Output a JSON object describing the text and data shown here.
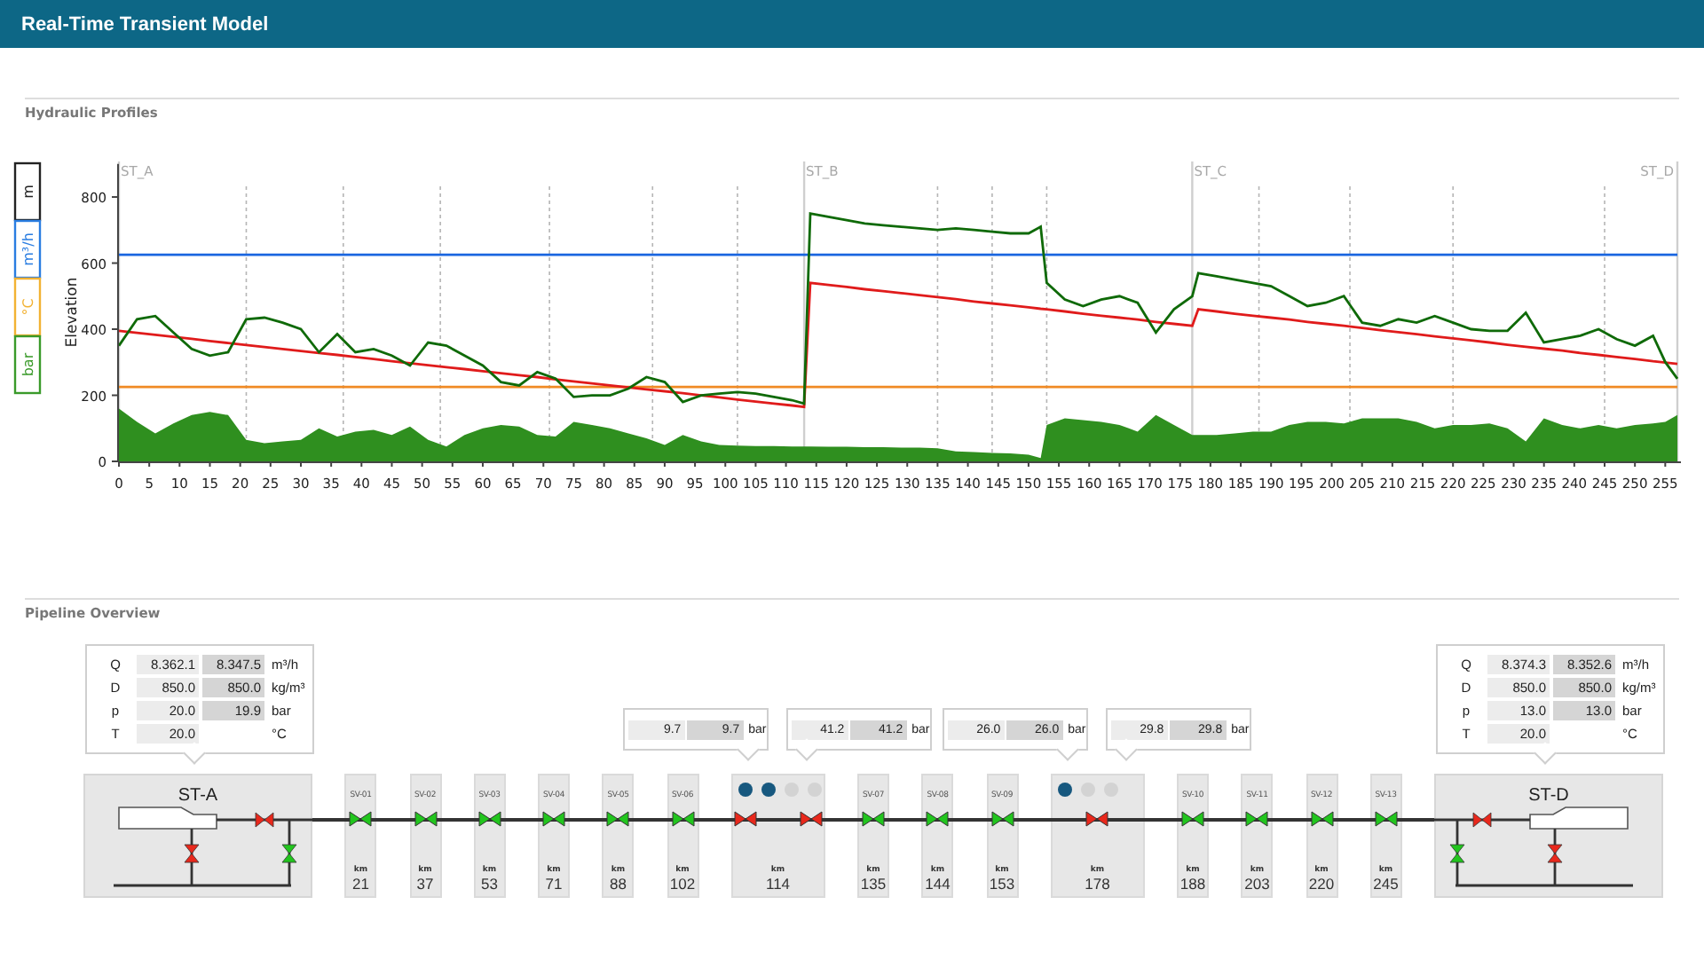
{
  "header": {
    "title": "Real-Time Transient Model"
  },
  "hydraulic_profiles": {
    "title": "Hydraulic Profiles",
    "unit_tabs": [
      {
        "label": "m",
        "color": "#222222"
      },
      {
        "label": "m³/h",
        "color": "#2a7de1"
      },
      {
        "label": "°C",
        "color": "#f2b233"
      },
      {
        "label": "bar",
        "color": "#3a9a2a"
      }
    ],
    "chart_data": {
      "type": "line",
      "ylabel": "Elevation",
      "xlim": [
        0,
        257
      ],
      "ylim": [
        0,
        900
      ],
      "xticks": [
        0,
        5,
        10,
        15,
        20,
        25,
        30,
        35,
        40,
        45,
        50,
        55,
        60,
        65,
        70,
        75,
        80,
        85,
        90,
        95,
        100,
        105,
        110,
        115,
        120,
        125,
        130,
        135,
        140,
        145,
        150,
        155,
        160,
        165,
        170,
        175,
        180,
        185,
        190,
        195,
        200,
        205,
        210,
        215,
        220,
        225,
        230,
        235,
        240,
        245,
        250,
        255
      ],
      "yticks": [
        0,
        200,
        400,
        600,
        800
      ],
      "grid": true,
      "ref_lines": [
        {
          "axis": "x",
          "value": 0,
          "label": "ST_A"
        },
        {
          "axis": "x",
          "value": 113,
          "label": "ST_B"
        },
        {
          "axis": "x",
          "value": 177,
          "label": "ST_C"
        },
        {
          "axis": "x",
          "value": 257,
          "label": "ST_D"
        }
      ],
      "x": [
        0,
        3,
        6,
        9,
        12,
        15,
        18,
        21,
        24,
        27,
        30,
        33,
        36,
        39,
        42,
        45,
        48,
        51,
        54,
        57,
        60,
        63,
        66,
        69,
        72,
        75,
        78,
        81,
        84,
        87,
        90,
        93,
        96,
        99,
        102,
        105,
        108,
        111,
        113,
        114,
        117,
        120,
        123,
        126,
        129,
        132,
        135,
        138,
        141,
        144,
        147,
        150,
        152,
        153,
        156,
        159,
        162,
        165,
        168,
        171,
        174,
        177,
        178,
        181,
        184,
        187,
        190,
        193,
        196,
        199,
        202,
        205,
        208,
        211,
        214,
        217,
        220,
        223,
        226,
        229,
        232,
        235,
        238,
        241,
        244,
        247,
        250,
        253,
        255,
        257
      ],
      "series": [
        {
          "type": "area",
          "color": "#2f8f1f",
          "values": [
            160,
            120,
            85,
            115,
            140,
            150,
            140,
            65,
            55,
            60,
            65,
            100,
            75,
            90,
            95,
            80,
            105,
            65,
            45,
            80,
            100,
            110,
            105,
            80,
            75,
            120,
            110,
            100,
            85,
            70,
            50,
            80,
            60,
            50,
            48,
            46,
            46,
            45,
            45,
            45,
            44,
            44,
            43,
            43,
            42,
            42,
            40,
            30,
            28,
            26,
            24,
            20,
            10,
            110,
            130,
            125,
            120,
            110,
            90,
            140,
            110,
            80,
            80,
            80,
            85,
            90,
            90,
            110,
            120,
            120,
            115,
            130,
            130,
            130,
            120,
            100,
            110,
            110,
            115,
            100,
            60,
            130,
            110,
            100,
            110,
            100,
            110,
            115,
            120,
            140
          ]
        },
        {
          "color": "#f08a24",
          "values": [
            225,
            225,
            225,
            225,
            225,
            225,
            225,
            225,
            225,
            225,
            225,
            225,
            225,
            225,
            225,
            225,
            225,
            225,
            225,
            225,
            225,
            225,
            225,
            225,
            225,
            225,
            225,
            225,
            225,
            225,
            225,
            225,
            225,
            225,
            225,
            225,
            225,
            225,
            225,
            225,
            225,
            225,
            225,
            225,
            225,
            225,
            225,
            225,
            225,
            225,
            225,
            225,
            225,
            225,
            225,
            225,
            225,
            225,
            225,
            225,
            225,
            225,
            225,
            225,
            225,
            225,
            225,
            225,
            225,
            225,
            225,
            225,
            225,
            225,
            225,
            225,
            225,
            225,
            225,
            225,
            225,
            225,
            225,
            225,
            225,
            225,
            225,
            225,
            225,
            225
          ]
        },
        {
          "color": "#1a66e0",
          "values": [
            625,
            625,
            625,
            625,
            625,
            625,
            625,
            625,
            625,
            625,
            625,
            625,
            625,
            625,
            625,
            625,
            625,
            625,
            625,
            625,
            625,
            625,
            625,
            625,
            625,
            625,
            625,
            625,
            625,
            625,
            625,
            625,
            625,
            625,
            625,
            625,
            625,
            625,
            625,
            625,
            625,
            625,
            625,
            625,
            625,
            625,
            625,
            625,
            625,
            625,
            625,
            625,
            625,
            625,
            625,
            625,
            625,
            625,
            625,
            625,
            625,
            625,
            625,
            625,
            625,
            625,
            625,
            625,
            625,
            625,
            625,
            625,
            625,
            625,
            625,
            625,
            625,
            625,
            625,
            625,
            625,
            625,
            625,
            625,
            625,
            625,
            625,
            625,
            625,
            625
          ]
        },
        {
          "color": "#e01b1b",
          "values": [
            395,
            389,
            383,
            377,
            371,
            364,
            358,
            352,
            346,
            340,
            334,
            328,
            322,
            316,
            310,
            303,
            297,
            291,
            285,
            279,
            273,
            267,
            261,
            255,
            248,
            242,
            236,
            230,
            224,
            218,
            212,
            206,
            200,
            194,
            187,
            181,
            175,
            169,
            165,
            540,
            534,
            528,
            521,
            515,
            509,
            503,
            497,
            491,
            484,
            478,
            472,
            466,
            462,
            460,
            454,
            447,
            441,
            435,
            429,
            422,
            416,
            410,
            460,
            454,
            447,
            441,
            435,
            429,
            422,
            416,
            410,
            404,
            397,
            391,
            385,
            378,
            372,
            366,
            360,
            353,
            347,
            341,
            335,
            328,
            322,
            316,
            310,
            303,
            299,
            295
          ]
        },
        {
          "color": "#0f6a08",
          "values": [
            350,
            430,
            440,
            390,
            340,
            320,
            330,
            430,
            435,
            420,
            400,
            330,
            385,
            330,
            340,
            320,
            290,
            360,
            350,
            320,
            290,
            240,
            230,
            270,
            250,
            195,
            200,
            200,
            220,
            255,
            240,
            180,
            200,
            205,
            210,
            205,
            195,
            185,
            175,
            750,
            740,
            730,
            720,
            715,
            710,
            705,
            700,
            705,
            700,
            695,
            690,
            690,
            710,
            540,
            490,
            470,
            490,
            500,
            480,
            390,
            460,
            500,
            570,
            560,
            550,
            540,
            530,
            500,
            470,
            480,
            500,
            420,
            410,
            430,
            420,
            440,
            420,
            400,
            395,
            395,
            450,
            360,
            370,
            380,
            400,
            370,
            350,
            380,
            300,
            250
          ]
        }
      ]
    }
  },
  "pipeline_overview": {
    "title": "Pipeline Overview",
    "items": [
      {
        "kind": "station",
        "name": "ST-A",
        "mirrored": false,
        "valves": [
          {
            "open": false
          },
          {
            "open": false
          },
          {
            "open": true
          }
        ],
        "popup": {
          "rows": [
            {
              "label": "Q",
              "values": [
                "8.362.1",
                "8.347.5"
              ],
              "unit": "m³/h"
            },
            {
              "label": "D",
              "values": [
                "850.0",
                "850.0"
              ],
              "unit": "kg/m³"
            },
            {
              "label": "p",
              "values": [
                "20.0",
                "19.9"
              ],
              "unit": "bar"
            },
            {
              "label": "T",
              "values": [
                "20.0"
              ],
              "unit": "°C"
            }
          ]
        }
      },
      {
        "kind": "valve",
        "name": "SV-01",
        "km_label": "km",
        "km": "21",
        "open": true
      },
      {
        "kind": "valve",
        "name": "SV-02",
        "km_label": "km",
        "km": "37",
        "open": true
      },
      {
        "kind": "valve",
        "name": "SV-03",
        "km_label": "km",
        "km": "53",
        "open": true
      },
      {
        "kind": "valve",
        "name": "SV-04",
        "km_label": "km",
        "km": "71",
        "open": true
      },
      {
        "kind": "valve",
        "name": "SV-05",
        "km_label": "km",
        "km": "88",
        "open": true
      },
      {
        "kind": "valve",
        "name": "SV-06",
        "km_label": "km",
        "km": "102",
        "open": true
      },
      {
        "kind": "pump",
        "km_label": "km",
        "km": "114",
        "dots": [
          {
            "on": true
          },
          {
            "on": true
          },
          {
            "on": false
          },
          {
            "on": false
          }
        ],
        "valves": [
          {
            "open": false
          },
          {
            "open": false
          }
        ],
        "popups": [
          {
            "values": [
              "9.7",
              "9.7"
            ],
            "unit": "bar"
          },
          {
            "values": [
              "41.2",
              "41.2"
            ],
            "unit": "bar"
          }
        ]
      },
      {
        "kind": "valve",
        "name": "SV-07",
        "km_label": "km",
        "km": "135",
        "open": true
      },
      {
        "kind": "valve",
        "name": "SV-08",
        "km_label": "km",
        "km": "144",
        "open": true
      },
      {
        "kind": "valve",
        "name": "SV-09",
        "km_label": "km",
        "km": "153",
        "open": true
      },
      {
        "kind": "pump",
        "km_label": "km",
        "km": "178",
        "dots": [
          {
            "on": true
          },
          {
            "on": false
          },
          {
            "on": false
          }
        ],
        "valves": [
          {
            "open": false
          }
        ],
        "popups": [
          {
            "values": [
              "26.0",
              "26.0"
            ],
            "unit": "bar"
          },
          {
            "values": [
              "29.8",
              "29.8"
            ],
            "unit": "bar"
          }
        ]
      },
      {
        "kind": "valve",
        "name": "SV-10",
        "km_label": "km",
        "km": "188",
        "open": true
      },
      {
        "kind": "valve",
        "name": "SV-11",
        "km_label": "km",
        "km": "203",
        "open": true
      },
      {
        "kind": "valve",
        "name": "SV-12",
        "km_label": "km",
        "km": "220",
        "open": true
      },
      {
        "kind": "valve",
        "name": "SV-13",
        "km_label": "km",
        "km": "245",
        "open": true
      },
      {
        "kind": "station",
        "name": "ST-D",
        "mirrored": true,
        "valves": [
          {
            "open": false
          },
          {
            "open": false
          },
          {
            "open": true
          }
        ],
        "popup": {
          "rows": [
            {
              "label": "Q",
              "values": [
                "8.374.3",
                "8.352.6"
              ],
              "unit": "m³/h"
            },
            {
              "label": "D",
              "values": [
                "850.0",
                "850.0"
              ],
              "unit": "kg/m³"
            },
            {
              "label": "p",
              "values": [
                "13.0",
                "13.0"
              ],
              "unit": "bar"
            },
            {
              "label": "T",
              "values": [
                "20.0"
              ],
              "unit": "°C"
            }
          ]
        }
      }
    ]
  }
}
